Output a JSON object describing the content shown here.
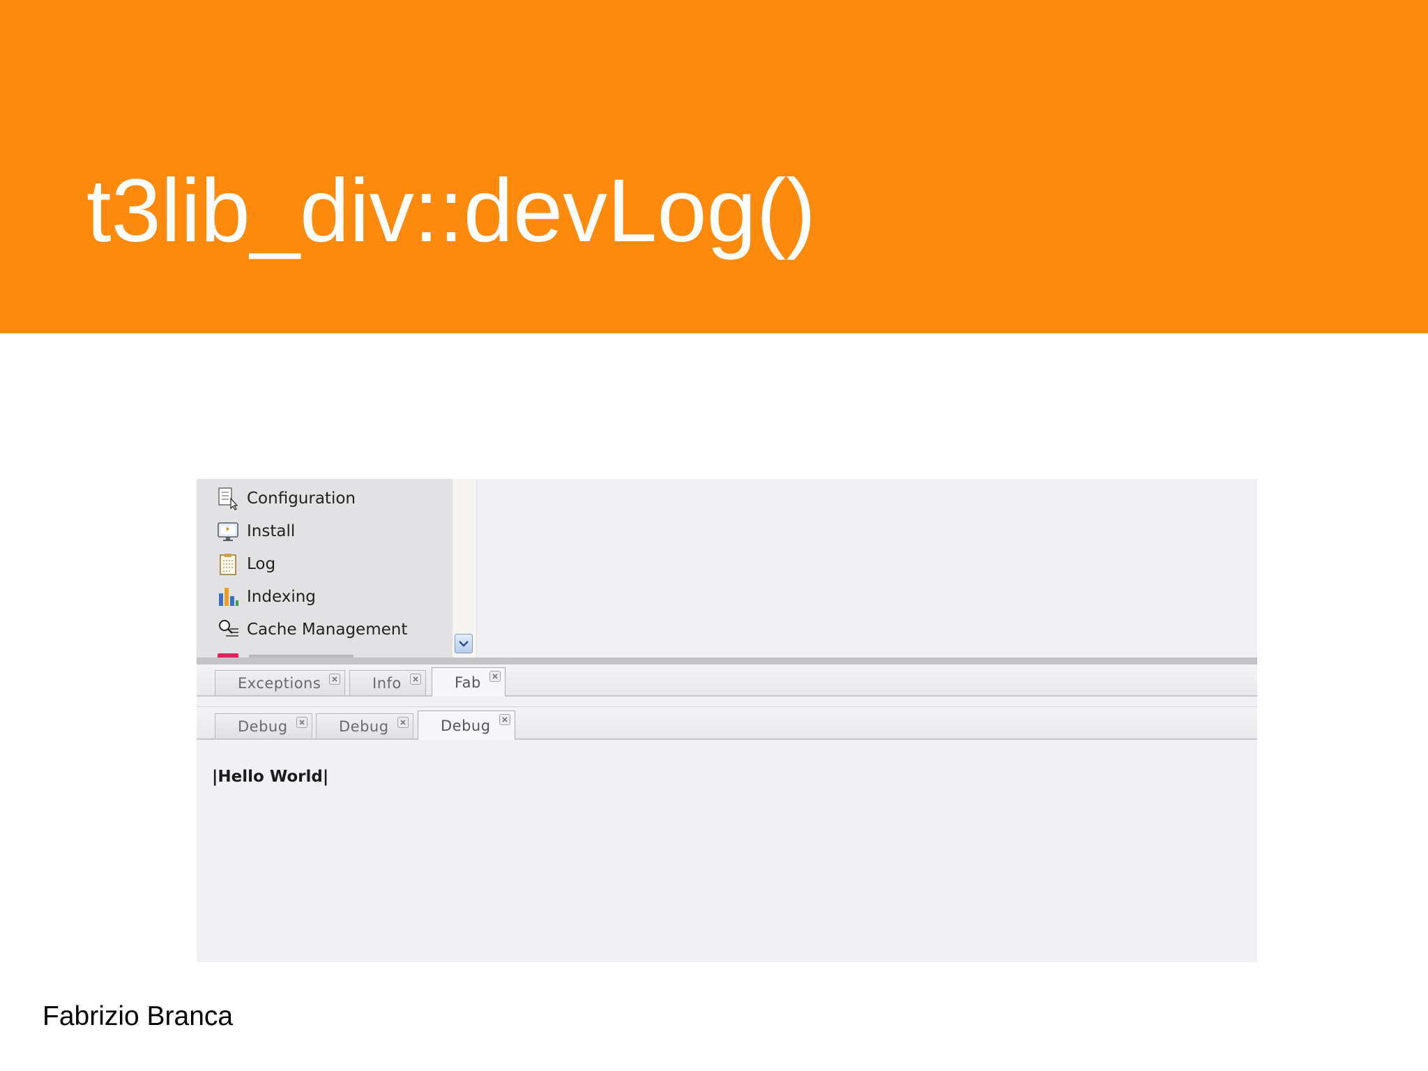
{
  "slide": {
    "title": "t3lib_div::devLog()",
    "author": "Fabrizio Branca",
    "header_color": "#fe8a0d"
  },
  "module_menu": {
    "items": [
      {
        "label": "Configuration",
        "icon": "configuration-icon"
      },
      {
        "label": "Install",
        "icon": "install-icon"
      },
      {
        "label": "Log",
        "icon": "log-icon"
      },
      {
        "label": "Indexing",
        "icon": "indexing-icon"
      },
      {
        "label": "Cache Management",
        "icon": "cache-management-icon"
      }
    ],
    "scroll_icon": "chevron-down-icon"
  },
  "tabs_row1": [
    {
      "label": "Exceptions",
      "active": false
    },
    {
      "label": "Info",
      "active": false
    },
    {
      "label": "Fab",
      "active": true
    }
  ],
  "tabs_row2": [
    {
      "label": "Debug",
      "active": false
    },
    {
      "label": "Debug",
      "active": false
    },
    {
      "label": "Debug",
      "active": true
    }
  ],
  "log_output": {
    "text": "|Hello World|"
  },
  "colors": {
    "menu_background": "#e2e1e4",
    "panel_background": "#f1f0f4",
    "splitter": "#c3c3c7"
  }
}
